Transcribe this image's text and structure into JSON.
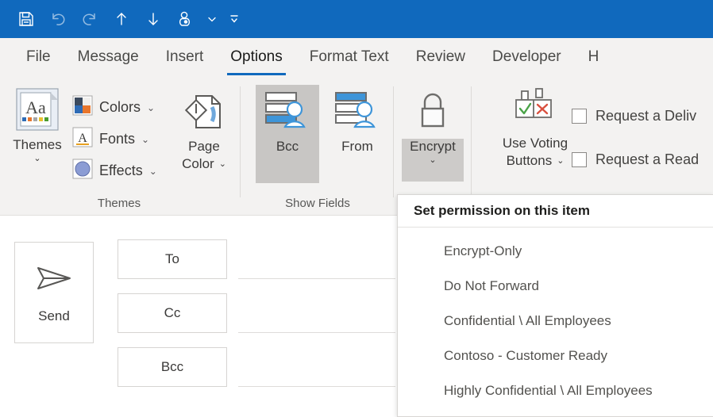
{
  "window": {
    "title": "Untitled - Message (HTML)",
    "titlebar_color": "#1069bd",
    "ribbon_color": "#f3f2f1",
    "accent_color": "#1069bd"
  },
  "quick_access_toolbar": {
    "items": [
      {
        "name": "save-icon",
        "label": "Save",
        "enabled": true
      },
      {
        "name": "undo-icon",
        "label": "Undo",
        "enabled": false
      },
      {
        "name": "redo-icon",
        "label": "Redo",
        "enabled": false
      },
      {
        "name": "previous-item-icon",
        "label": "Previous Item",
        "enabled": true
      },
      {
        "name": "next-item-icon",
        "label": "Next Item",
        "enabled": true
      },
      {
        "name": "touch-mouse-mode-icon",
        "label": "Touch/Mouse Mode",
        "enabled": true
      },
      {
        "name": "qat-dropdown-icon",
        "label": "Touch/Mouse Mode Dropdown",
        "enabled": true
      },
      {
        "name": "customize-qat-icon",
        "label": "Customize Quick Access Toolbar",
        "enabled": true
      }
    ]
  },
  "tabs": {
    "items": [
      {
        "label": "File",
        "active": false
      },
      {
        "label": "Message",
        "active": false
      },
      {
        "label": "Insert",
        "active": false
      },
      {
        "label": "Options",
        "active": true
      },
      {
        "label": "Format Text",
        "active": false
      },
      {
        "label": "Review",
        "active": false
      },
      {
        "label": "Developer",
        "active": false
      },
      {
        "label": "H",
        "active": false
      }
    ]
  },
  "ribbon": {
    "groups": [
      {
        "title": "Themes"
      },
      {
        "title": "Show Fields"
      }
    ],
    "themes": {
      "button_label": "Themes",
      "chevron": "⌄",
      "colors_label": "Colors",
      "fonts_label": "Fonts",
      "effects_label": "Effects",
      "dropdown_chevron": "⌄",
      "page_color_line1": "Page",
      "page_color_line2": "Color",
      "swatch_colors": [
        "#3b4a5e",
        "#f0efed",
        "#2e6bb5",
        "#e8762c"
      ]
    },
    "show_fields": {
      "bcc_label": "Bcc",
      "bcc_selected": true,
      "from_label": "From",
      "from_selected": false
    },
    "permission": {
      "encrypt_label": "Encrypt",
      "encrypt_chevron": "⌄",
      "encrypt_active": true
    },
    "tracking": {
      "voting_line1": "Use Voting",
      "voting_line2": "Buttons",
      "voting_chevron": "⌄",
      "request_delivery_label": "Request a Deliv",
      "request_delivery_checked": false,
      "request_read_label": "Request a Read",
      "request_read_checked": false
    }
  },
  "compose": {
    "send_label": "Send",
    "fields": [
      {
        "button_label": "To",
        "value": ""
      },
      {
        "button_label": "Cc",
        "value": ""
      },
      {
        "button_label": "Bcc",
        "value": ""
      }
    ]
  },
  "encrypt_menu": {
    "header": "Set permission on this item",
    "items": [
      {
        "label": "Encrypt-Only"
      },
      {
        "label": "Do Not Forward"
      },
      {
        "label": "Confidential \\ All Employees"
      },
      {
        "label": "Contoso - Customer Ready"
      },
      {
        "label": "Highly Confidential \\ All Employees"
      }
    ]
  }
}
